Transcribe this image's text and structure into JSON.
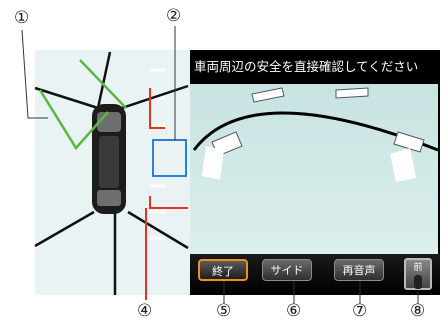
{
  "callouts": {
    "c1": "①",
    "c2": "②",
    "c4": "④",
    "c5": "⑤",
    "c6": "⑥",
    "c7": "⑦",
    "c8": "⑧"
  },
  "header": {
    "message": "車両周辺の安全を直接確認してください"
  },
  "buttons": {
    "end_label": "終了",
    "side_label": "サイド",
    "replay_label": "再音声"
  },
  "rear_toggle": {
    "label": "前"
  },
  "colors": {
    "guide_line_green": "#59b845",
    "callout_line_red": "#e8311e",
    "highlight_blue": "#2b7fd6",
    "active_orange": "#f0901a"
  }
}
